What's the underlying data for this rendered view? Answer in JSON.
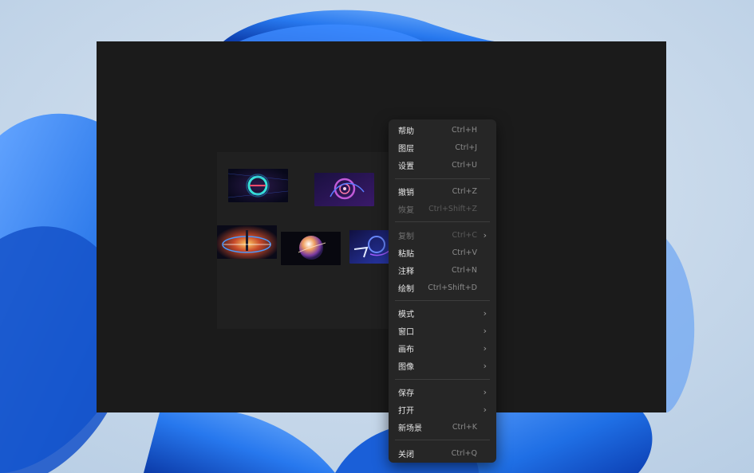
{
  "colors": {
    "window_bg": "#1b1b1b",
    "board_bg": "#202020",
    "menu_bg": "#262626",
    "menu_text": "#e6e6e6",
    "menu_shortcut": "#8a8a8a",
    "menu_disabled": "#707070",
    "wallpaper_bg": "#c9d9ea",
    "wallpaper_accent": "#1f6fe5"
  },
  "thumbnails": [
    {
      "name": "thumbnail-ring",
      "icon": "ring-image"
    },
    {
      "name": "thumbnail-swirl",
      "icon": "swirl-image"
    },
    {
      "name": "thumbnail-flare",
      "icon": "flare-image"
    },
    {
      "name": "thumbnail-planet",
      "icon": "planet-image"
    },
    {
      "name": "thumbnail-abstract",
      "icon": "abstract-image"
    }
  ],
  "menu": {
    "groups": [
      [
        {
          "label": "帮助",
          "shortcut": "Ctrl+H",
          "submenu": false,
          "disabled": false
        },
        {
          "label": "图层",
          "shortcut": "Ctrl+J",
          "submenu": false,
          "disabled": false
        },
        {
          "label": "设置",
          "shortcut": "Ctrl+U",
          "submenu": false,
          "disabled": false
        }
      ],
      [
        {
          "label": "撤销",
          "shortcut": "Ctrl+Z",
          "submenu": false,
          "disabled": false
        },
        {
          "label": "恢复",
          "shortcut": "Ctrl+Shift+Z",
          "submenu": false,
          "disabled": true
        }
      ],
      [
        {
          "label": "复制",
          "shortcut": "Ctrl+C",
          "submenu": true,
          "disabled": true
        },
        {
          "label": "粘贴",
          "shortcut": "Ctrl+V",
          "submenu": false,
          "disabled": false
        },
        {
          "label": "注释",
          "shortcut": "Ctrl+N",
          "submenu": false,
          "disabled": false
        },
        {
          "label": "绘制",
          "shortcut": "Ctrl+Shift+D",
          "submenu": false,
          "disabled": false
        }
      ],
      [
        {
          "label": "模式",
          "shortcut": "",
          "submenu": true,
          "disabled": false
        },
        {
          "label": "窗口",
          "shortcut": "",
          "submenu": true,
          "disabled": false
        },
        {
          "label": "画布",
          "shortcut": "",
          "submenu": true,
          "disabled": false
        },
        {
          "label": "图像",
          "shortcut": "",
          "submenu": true,
          "disabled": false
        }
      ],
      [
        {
          "label": "保存",
          "shortcut": "",
          "submenu": true,
          "disabled": false
        },
        {
          "label": "打开",
          "shortcut": "",
          "submenu": true,
          "disabled": false
        },
        {
          "label": "新场景",
          "shortcut": "Ctrl+K",
          "submenu": false,
          "disabled": false
        }
      ],
      [
        {
          "label": "关闭",
          "shortcut": "Ctrl+Q",
          "submenu": false,
          "disabled": false
        }
      ]
    ],
    "submenu_glyph": "›"
  }
}
